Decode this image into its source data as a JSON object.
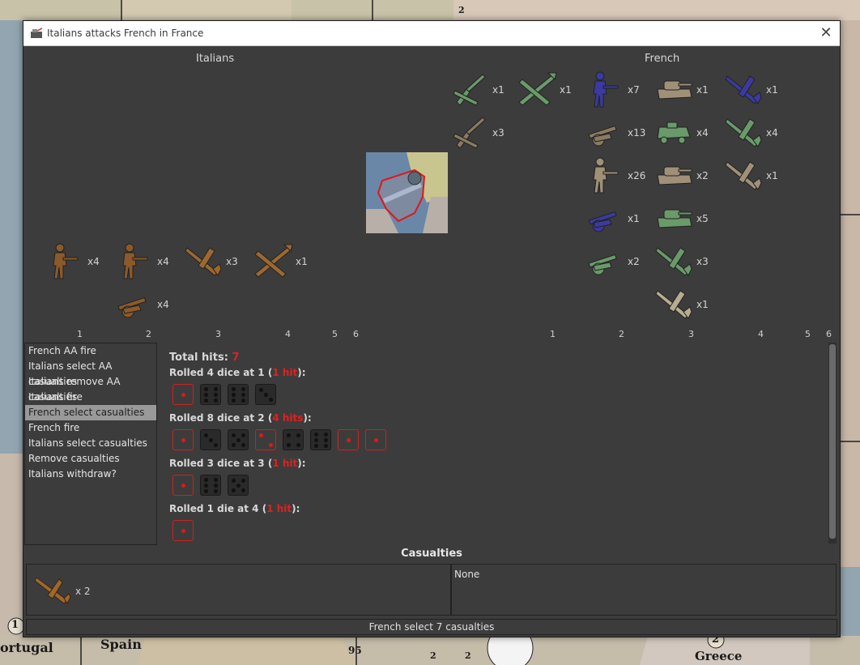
{
  "window": {
    "title": "Italians attacks French in France"
  },
  "sides": {
    "attacker": "Italians",
    "defender": "French"
  },
  "attacker_units": [
    {
      "icon": "italian-infantry-icon",
      "count": "x4"
    },
    {
      "icon": "italian-infantry-icon",
      "count": "x4"
    },
    {
      "icon": "italian-fighter-icon",
      "count": "x3"
    },
    {
      "icon": "italian-bomber-icon",
      "count": "x1"
    },
    {
      "icon": "italian-artillery-icon",
      "count": "x4"
    }
  ],
  "defender_units": [
    {
      "icon": "aa-gun-icon",
      "count": "x1"
    },
    {
      "icon": "bomber-icon",
      "count": "x1"
    },
    {
      "icon": "aa-gun-icon",
      "count": "x3"
    },
    {
      "icon": "infantry-icon",
      "count": "x7"
    },
    {
      "icon": "artillery-icon",
      "count": "x13"
    },
    {
      "icon": "infantry-icon",
      "count": "x26"
    },
    {
      "icon": "artillery-icon",
      "count": "x1"
    },
    {
      "icon": "artillery-icon",
      "count": "x2"
    },
    {
      "icon": "tank-icon",
      "count": "x1"
    },
    {
      "icon": "armored-car-icon",
      "count": "x4"
    },
    {
      "icon": "tank-icon",
      "count": "x2"
    },
    {
      "icon": "tank-icon",
      "count": "x5"
    },
    {
      "icon": "fighter-icon",
      "count": "x3"
    },
    {
      "icon": "fighter-icon",
      "count": "x1"
    },
    {
      "icon": "fighter-icon",
      "count": "x1"
    },
    {
      "icon": "fighter-icon",
      "count": "x4"
    },
    {
      "icon": "fighter-icon",
      "count": "x1"
    }
  ],
  "column_numbers": {
    "attacker": [
      "1",
      "2",
      "3",
      "4",
      "5",
      "6"
    ],
    "defender": [
      "1",
      "2",
      "3",
      "4",
      "5",
      "6"
    ]
  },
  "steps": [
    {
      "label": "French AA fire",
      "selected": false
    },
    {
      "label": "Italians select AA casualties",
      "selected": false
    },
    {
      "label": "Italians remove AA casualties",
      "selected": false
    },
    {
      "label": "Italians fire",
      "selected": false
    },
    {
      "label": "French select casualties",
      "selected": true
    },
    {
      "label": "French fire",
      "selected": false
    },
    {
      "label": "Italians select casualties",
      "selected": false
    },
    {
      "label": "Remove casualties",
      "selected": false
    },
    {
      "label": "Italians withdraw?",
      "selected": false
    }
  ],
  "dice": {
    "total_label": "Total hits: ",
    "total_value": "7",
    "rolls": [
      {
        "prefix": "Rolled 4 dice at 1 (",
        "hits": "1 hit",
        "suffix": "):",
        "faces": [
          1,
          6,
          6,
          3
        ],
        "hit": [
          true,
          false,
          false,
          false
        ]
      },
      {
        "prefix": "Rolled 8 dice at 2 (",
        "hits": "4 hits",
        "suffix": "):",
        "faces": [
          1,
          3,
          5,
          2,
          4,
          6,
          1,
          1
        ],
        "hit": [
          true,
          false,
          false,
          true,
          false,
          false,
          true,
          true
        ]
      },
      {
        "prefix": "Rolled 3 dice at 3 (",
        "hits": "1 hit",
        "suffix": "):",
        "faces": [
          1,
          6,
          5
        ],
        "hit": [
          true,
          false,
          false
        ]
      },
      {
        "prefix": "Rolled 1 die at 4 (",
        "hits": "1 hit",
        "suffix": "):",
        "faces": [
          1
        ],
        "hit": [
          true
        ]
      }
    ]
  },
  "casualties": {
    "title": "Casualties",
    "attacker_unit_icon": "italian-fighter-icon",
    "attacker_count": "x 2",
    "defender_text": "None"
  },
  "status": "French select 7 casualties",
  "map_labels": [
    "ortugal",
    "Spain",
    "Greece",
    "95",
    "2",
    "2",
    "2",
    "1",
    "2"
  ],
  "colors": {
    "italian": "#8b5a2b",
    "french_green": "#6a9a6a",
    "french_blue": "#3a3aa0",
    "hit_red": "#e02020"
  }
}
